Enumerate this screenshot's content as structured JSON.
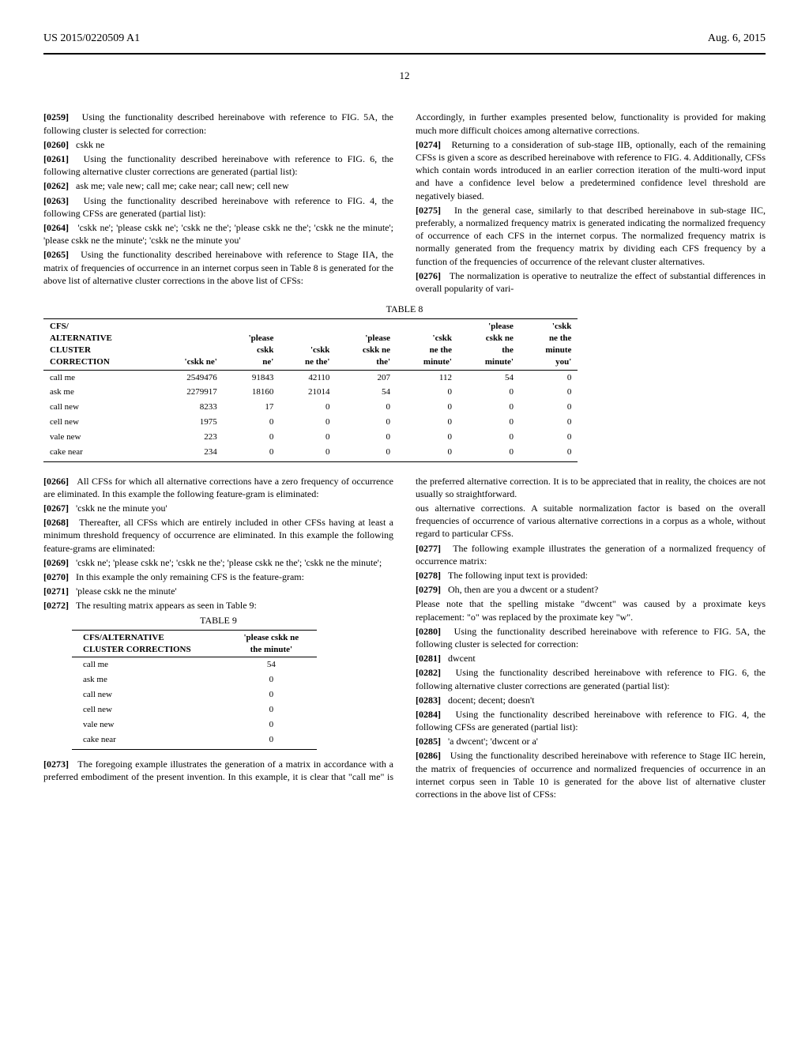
{
  "header": {
    "pub_number": "US 2015/0220509 A1",
    "pub_date": "Aug. 6, 2015",
    "page_number": "12"
  },
  "col1": {
    "p0259": "Using the functionality described hereinabove with reference to FIG. 5A, the following cluster is selected for correction:",
    "p0260": "cskk ne",
    "p0261": "Using the functionality described hereinabove with reference to FIG. 6, the following alternative cluster corrections are generated (partial list):",
    "p0262": "ask me; vale new; call me; cake near; call new; cell new",
    "p0263": "Using the functionality described hereinabove with reference to FIG. 4, the following CFSs are generated (partial list):",
    "p0264": "'cskk ne'; 'please cskk ne'; 'cskk ne the'; 'please cskk ne the'; 'cskk ne the minute'; 'please cskk ne the minute'; 'cskk ne the minute you'",
    "p0265": "Using the functionality described hereinabove with reference to Stage IIA, the matrix of frequencies of occurrence in an internet corpus seen in Table 8 is generated for the above list of alternative cluster corrections in the above list of CFSs:",
    "p0266": "All CFSs for which all alternative corrections have a zero frequency of occurrence are eliminated. In this example the following feature-gram is eliminated:",
    "p0267": "'cskk ne the minute you'",
    "p0268": "Thereafter, all CFSs which are entirely included in other CFSs having at least a minimum threshold frequency of occurrence are eliminated. In this example the following feature-grams are eliminated:",
    "p0269": "'cskk ne'; 'please cskk ne'; 'cskk ne the'; 'please cskk ne the'; 'cskk ne the minute';",
    "p0270": "In this example the only remaining CFS is the feature-gram:",
    "p0271": "'please cskk ne the minute'",
    "p0272": "The resulting matrix appears as seen in Table 9:",
    "p0273": "The foregoing example illustrates the generation of a matrix in accordance with a preferred embodiment of the present invention. In this example, it is clear that \"call me\" is the preferred alternative correction. It is to be appreciated that in reality, the choices are not usually so straightforward."
  },
  "col2": {
    "pA": "Accordingly, in further examples presented below, functionality is provided for making much more difficult choices among alternative corrections.",
    "p0274": "Returning to a consideration of sub-stage IIB, optionally, each of the remaining CFSs is given a score as described hereinabove with reference to FIG. 4. Additionally, CFSs which contain words introduced in an earlier correction iteration of the multi-word input and have a confidence level below a predetermined confidence level threshold are negatively biased.",
    "p0275": "In the general case, similarly to that described hereinabove in sub-stage IIC, preferably, a normalized frequency matrix is generated indicating the normalized frequency of occurrence of each CFS in the internet corpus. The normalized frequency matrix is normally generated from the frequency matrix by dividing each CFS frequency by a function of the frequencies of occurrence of the relevant cluster alternatives.",
    "p0276": "The normalization is operative to neutralize the effect of substantial differences in overall popularity of vari-",
    "pB": "ous alternative corrections. A suitable normalization factor is based on the overall frequencies of occurrence of various alternative corrections in a corpus as a whole, without regard to particular CFSs.",
    "p0277": "The following example illustrates the generation of a normalized frequency of occurrence matrix:",
    "p0278": "The following input text is provided:",
    "p0279": "Oh, then are you a dwcent or a student?",
    "pC": "Please note that the spelling mistake \"dwcent\" was caused by a proximate keys replacement: \"o\" was replaced by the proximate key \"w\".",
    "p0280": "Using the functionality described hereinabove with reference to FIG. 5A, the following cluster is selected for correction:",
    "p0281": "dwcent",
    "p0282": "Using the functionality described hereinabove with reference to FIG. 6, the following alternative cluster corrections are generated (partial list):",
    "p0283": "docent; decent; doesn't",
    "p0284": "Using the functionality described hereinabove with reference to FIG. 4, the following CFSs are generated (partial list):",
    "p0285": "'a dwcent'; 'dwcent or a'",
    "p0286": "Using the functionality described hereinabove with reference to Stage IIC herein, the matrix of frequencies of occurrence and normalized frequencies of occurrence in an internet corpus seen in Table 10 is generated for the above list of alternative cluster corrections in the above list of CFSs:"
  },
  "labels": {
    "l0259": "[0259]",
    "l0260": "[0260]",
    "l0261": "[0261]",
    "l0262": "[0262]",
    "l0263": "[0263]",
    "l0264": "[0264]",
    "l0265": "[0265]",
    "l0266": "[0266]",
    "l0267": "[0267]",
    "l0268": "[0268]",
    "l0269": "[0269]",
    "l0270": "[0270]",
    "l0271": "[0271]",
    "l0272": "[0272]",
    "l0273": "[0273]",
    "l0274": "[0274]",
    "l0275": "[0275]",
    "l0276": "[0276]",
    "l0277": "[0277]",
    "l0278": "[0278]",
    "l0279": "[0279]",
    "l0280": "[0280]",
    "l0281": "[0281]",
    "l0282": "[0282]",
    "l0283": "[0283]",
    "l0284": "[0284]",
    "l0285": "[0285]",
    "l0286": "[0286]"
  },
  "table8": {
    "title": "TABLE 8",
    "headers": [
      "CFS/\nALTERNATIVE\nCLUSTER\nCORRECTION",
      "'cskk ne'",
      "'please\ncskk\nne'",
      "'cskk\nne the'",
      "'please\ncskk ne\nthe'",
      "'cskk\nne the\nminute'",
      "'please\ncskk ne\nthe\nminute'",
      "'cskk\nne the\nminute\nyou'"
    ],
    "rows": [
      [
        "call me",
        "2549476",
        "91843",
        "42110",
        "207",
        "112",
        "54",
        "0"
      ],
      [
        "ask me",
        "2279917",
        "18160",
        "21014",
        "54",
        "0",
        "0",
        "0"
      ],
      [
        "call new",
        "8233",
        "17",
        "0",
        "0",
        "0",
        "0",
        "0"
      ],
      [
        "cell new",
        "1975",
        "0",
        "0",
        "0",
        "0",
        "0",
        "0"
      ],
      [
        "vale new",
        "223",
        "0",
        "0",
        "0",
        "0",
        "0",
        "0"
      ],
      [
        "cake near",
        "234",
        "0",
        "0",
        "0",
        "0",
        "0",
        "0"
      ]
    ]
  },
  "table9": {
    "title": "TABLE 9",
    "headers": [
      "CFS/ALTERNATIVE\nCLUSTER CORRECTIONS",
      "'please cskk ne\nthe minute'"
    ],
    "rows": [
      [
        "call me",
        "54"
      ],
      [
        "ask me",
        "0"
      ],
      [
        "call new",
        "0"
      ],
      [
        "cell new",
        "0"
      ],
      [
        "vale new",
        "0"
      ],
      [
        "cake near",
        "0"
      ]
    ]
  },
  "chart_data": [
    {
      "type": "table",
      "title": "TABLE 8",
      "columns": [
        "CFS/ALTERNATIVE CLUSTER CORRECTION",
        "'cskk ne'",
        "'please cskk ne'",
        "'cskk ne the'",
        "'please cskk ne the'",
        "'cskk ne the minute'",
        "'please cskk ne the minute'",
        "'cskk ne the minute you'"
      ],
      "rows": [
        [
          "call me",
          2549476,
          91843,
          42110,
          207,
          112,
          54,
          0
        ],
        [
          "ask me",
          2279917,
          18160,
          21014,
          54,
          0,
          0,
          0
        ],
        [
          "call new",
          8233,
          17,
          0,
          0,
          0,
          0,
          0
        ],
        [
          "cell new",
          1975,
          0,
          0,
          0,
          0,
          0,
          0
        ],
        [
          "vale new",
          223,
          0,
          0,
          0,
          0,
          0,
          0
        ],
        [
          "cake near",
          234,
          0,
          0,
          0,
          0,
          0,
          0
        ]
      ]
    },
    {
      "type": "table",
      "title": "TABLE 9",
      "columns": [
        "CFS/ALTERNATIVE CLUSTER CORRECTIONS",
        "'please cskk ne the minute'"
      ],
      "rows": [
        [
          "call me",
          54
        ],
        [
          "ask me",
          0
        ],
        [
          "call new",
          0
        ],
        [
          "cell new",
          0
        ],
        [
          "vale new",
          0
        ],
        [
          "cake near",
          0
        ]
      ]
    }
  ]
}
